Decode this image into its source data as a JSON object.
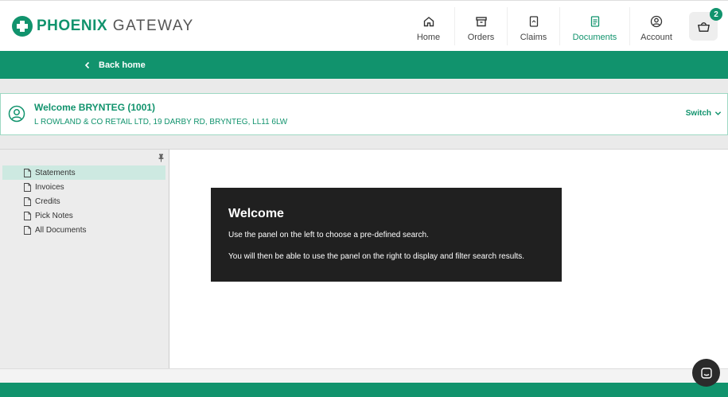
{
  "brand": {
    "name_bold": "PHOENIX",
    "name_light": " GATEWAY",
    "color": "#11936d"
  },
  "nav": {
    "items": [
      {
        "label": "Home",
        "icon": "home-icon"
      },
      {
        "label": "Orders",
        "icon": "archive-box-icon"
      },
      {
        "label": "Claims",
        "icon": "claim-document-icon"
      },
      {
        "label": "Documents",
        "icon": "documents-icon",
        "active": true
      },
      {
        "label": "Account",
        "icon": "user-circle-icon"
      }
    ],
    "cart_count": "2"
  },
  "backbar": {
    "label": "Back home"
  },
  "account": {
    "title": "Welcome BRYNTEG (1001)",
    "address": "L ROWLAND & CO RETAIL LTD, 19 DARBY RD, BRYNTEG, LL11 6LW",
    "switch_label": "Switch"
  },
  "sidebar": {
    "items": [
      {
        "label": "Statements",
        "selected": true
      },
      {
        "label": "Invoices"
      },
      {
        "label": "Credits"
      },
      {
        "label": "Pick Notes"
      },
      {
        "label": "All Documents"
      }
    ]
  },
  "welcome": {
    "title": "Welcome",
    "line1": "Use the panel on the left to choose a pre-defined search.",
    "line2": "You will then be able to use the panel on the right to display and filter search results."
  }
}
